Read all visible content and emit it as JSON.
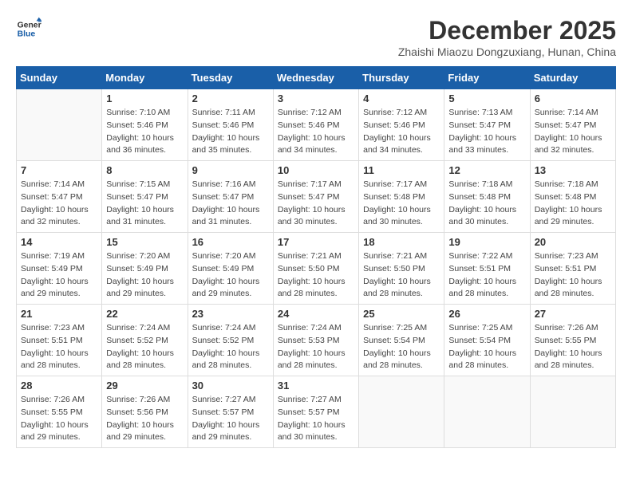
{
  "header": {
    "logo_line1": "General",
    "logo_line2": "Blue",
    "month_title": "December 2025",
    "location": "Zhaishi Miaozu Dongzuxiang, Hunan, China"
  },
  "weekdays": [
    "Sunday",
    "Monday",
    "Tuesday",
    "Wednesday",
    "Thursday",
    "Friday",
    "Saturday"
  ],
  "weeks": [
    [
      {
        "day": "",
        "empty": true
      },
      {
        "day": "1",
        "sunrise": "Sunrise: 7:10 AM",
        "sunset": "Sunset: 5:46 PM",
        "daylight": "Daylight: 10 hours and 36 minutes."
      },
      {
        "day": "2",
        "sunrise": "Sunrise: 7:11 AM",
        "sunset": "Sunset: 5:46 PM",
        "daylight": "Daylight: 10 hours and 35 minutes."
      },
      {
        "day": "3",
        "sunrise": "Sunrise: 7:12 AM",
        "sunset": "Sunset: 5:46 PM",
        "daylight": "Daylight: 10 hours and 34 minutes."
      },
      {
        "day": "4",
        "sunrise": "Sunrise: 7:12 AM",
        "sunset": "Sunset: 5:46 PM",
        "daylight": "Daylight: 10 hours and 34 minutes."
      },
      {
        "day": "5",
        "sunrise": "Sunrise: 7:13 AM",
        "sunset": "Sunset: 5:47 PM",
        "daylight": "Daylight: 10 hours and 33 minutes."
      },
      {
        "day": "6",
        "sunrise": "Sunrise: 7:14 AM",
        "sunset": "Sunset: 5:47 PM",
        "daylight": "Daylight: 10 hours and 32 minutes."
      }
    ],
    [
      {
        "day": "7",
        "sunrise": "Sunrise: 7:14 AM",
        "sunset": "Sunset: 5:47 PM",
        "daylight": "Daylight: 10 hours and 32 minutes."
      },
      {
        "day": "8",
        "sunrise": "Sunrise: 7:15 AM",
        "sunset": "Sunset: 5:47 PM",
        "daylight": "Daylight: 10 hours and 31 minutes."
      },
      {
        "day": "9",
        "sunrise": "Sunrise: 7:16 AM",
        "sunset": "Sunset: 5:47 PM",
        "daylight": "Daylight: 10 hours and 31 minutes."
      },
      {
        "day": "10",
        "sunrise": "Sunrise: 7:17 AM",
        "sunset": "Sunset: 5:47 PM",
        "daylight": "Daylight: 10 hours and 30 minutes."
      },
      {
        "day": "11",
        "sunrise": "Sunrise: 7:17 AM",
        "sunset": "Sunset: 5:48 PM",
        "daylight": "Daylight: 10 hours and 30 minutes."
      },
      {
        "day": "12",
        "sunrise": "Sunrise: 7:18 AM",
        "sunset": "Sunset: 5:48 PM",
        "daylight": "Daylight: 10 hours and 30 minutes."
      },
      {
        "day": "13",
        "sunrise": "Sunrise: 7:18 AM",
        "sunset": "Sunset: 5:48 PM",
        "daylight": "Daylight: 10 hours and 29 minutes."
      }
    ],
    [
      {
        "day": "14",
        "sunrise": "Sunrise: 7:19 AM",
        "sunset": "Sunset: 5:49 PM",
        "daylight": "Daylight: 10 hours and 29 minutes."
      },
      {
        "day": "15",
        "sunrise": "Sunrise: 7:20 AM",
        "sunset": "Sunset: 5:49 PM",
        "daylight": "Daylight: 10 hours and 29 minutes."
      },
      {
        "day": "16",
        "sunrise": "Sunrise: 7:20 AM",
        "sunset": "Sunset: 5:49 PM",
        "daylight": "Daylight: 10 hours and 29 minutes."
      },
      {
        "day": "17",
        "sunrise": "Sunrise: 7:21 AM",
        "sunset": "Sunset: 5:50 PM",
        "daylight": "Daylight: 10 hours and 28 minutes."
      },
      {
        "day": "18",
        "sunrise": "Sunrise: 7:21 AM",
        "sunset": "Sunset: 5:50 PM",
        "daylight": "Daylight: 10 hours and 28 minutes."
      },
      {
        "day": "19",
        "sunrise": "Sunrise: 7:22 AM",
        "sunset": "Sunset: 5:51 PM",
        "daylight": "Daylight: 10 hours and 28 minutes."
      },
      {
        "day": "20",
        "sunrise": "Sunrise: 7:23 AM",
        "sunset": "Sunset: 5:51 PM",
        "daylight": "Daylight: 10 hours and 28 minutes."
      }
    ],
    [
      {
        "day": "21",
        "sunrise": "Sunrise: 7:23 AM",
        "sunset": "Sunset: 5:51 PM",
        "daylight": "Daylight: 10 hours and 28 minutes."
      },
      {
        "day": "22",
        "sunrise": "Sunrise: 7:24 AM",
        "sunset": "Sunset: 5:52 PM",
        "daylight": "Daylight: 10 hours and 28 minutes."
      },
      {
        "day": "23",
        "sunrise": "Sunrise: 7:24 AM",
        "sunset": "Sunset: 5:52 PM",
        "daylight": "Daylight: 10 hours and 28 minutes."
      },
      {
        "day": "24",
        "sunrise": "Sunrise: 7:24 AM",
        "sunset": "Sunset: 5:53 PM",
        "daylight": "Daylight: 10 hours and 28 minutes."
      },
      {
        "day": "25",
        "sunrise": "Sunrise: 7:25 AM",
        "sunset": "Sunset: 5:54 PM",
        "daylight": "Daylight: 10 hours and 28 minutes."
      },
      {
        "day": "26",
        "sunrise": "Sunrise: 7:25 AM",
        "sunset": "Sunset: 5:54 PM",
        "daylight": "Daylight: 10 hours and 28 minutes."
      },
      {
        "day": "27",
        "sunrise": "Sunrise: 7:26 AM",
        "sunset": "Sunset: 5:55 PM",
        "daylight": "Daylight: 10 hours and 28 minutes."
      }
    ],
    [
      {
        "day": "28",
        "sunrise": "Sunrise: 7:26 AM",
        "sunset": "Sunset: 5:55 PM",
        "daylight": "Daylight: 10 hours and 29 minutes."
      },
      {
        "day": "29",
        "sunrise": "Sunrise: 7:26 AM",
        "sunset": "Sunset: 5:56 PM",
        "daylight": "Daylight: 10 hours and 29 minutes."
      },
      {
        "day": "30",
        "sunrise": "Sunrise: 7:27 AM",
        "sunset": "Sunset: 5:57 PM",
        "daylight": "Daylight: 10 hours and 29 minutes."
      },
      {
        "day": "31",
        "sunrise": "Sunrise: 7:27 AM",
        "sunset": "Sunset: 5:57 PM",
        "daylight": "Daylight: 10 hours and 30 minutes."
      },
      {
        "day": "",
        "empty": true
      },
      {
        "day": "",
        "empty": true
      },
      {
        "day": "",
        "empty": true
      }
    ]
  ]
}
